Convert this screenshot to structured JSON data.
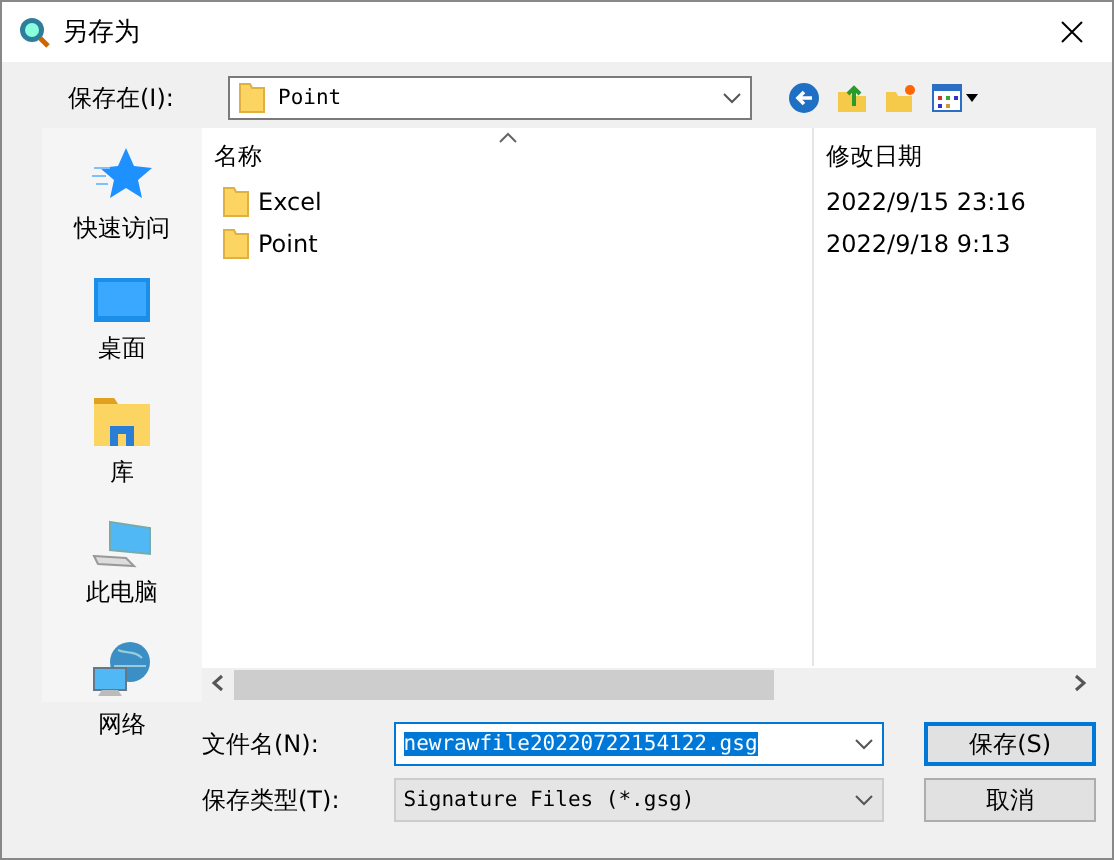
{
  "window": {
    "title": "另存为"
  },
  "save_in": {
    "label": "保存在(I):",
    "value": "Point"
  },
  "places": [
    {
      "kind": "quick",
      "label": "快速访问"
    },
    {
      "kind": "desktop",
      "label": "桌面"
    },
    {
      "kind": "library",
      "label": "库"
    },
    {
      "kind": "computer",
      "label": "此电脑"
    },
    {
      "kind": "network",
      "label": "网络"
    }
  ],
  "table": {
    "columns": [
      "名称",
      "修改日期"
    ],
    "rows": [
      {
        "name": "Excel",
        "modified": "2022/9/15 23:16"
      },
      {
        "name": "Point",
        "modified": "2022/9/18 9:13"
      }
    ]
  },
  "file_name": {
    "label": "文件名(N):",
    "value": "newrawfile20220722154122.gsg",
    "text_selected": true
  },
  "file_type": {
    "label": "保存类型(T):",
    "value": "Signature Files (*.gsg)"
  },
  "buttons": [
    {
      "label": "保存(S)",
      "default": true
    },
    {
      "label": "取消",
      "default": false
    }
  ]
}
